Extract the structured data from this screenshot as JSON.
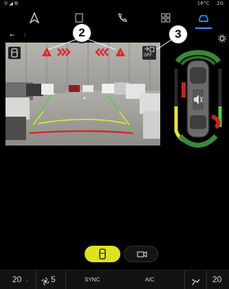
{
  "status": {
    "temperature": "16°C",
    "time": "20:"
  },
  "nav": {
    "items": [
      {
        "name": "navigation"
      },
      {
        "name": "media"
      },
      {
        "name": "phone"
      },
      {
        "name": "apps"
      },
      {
        "name": "vehicle"
      }
    ],
    "active": "vehicle"
  },
  "callouts": {
    "two": "2",
    "three": "3"
  },
  "camera": {
    "cross_traffic_label": "OFF"
  },
  "bottom_bar": {
    "left_temp": "20",
    "fan_speed": "5",
    "sync_label": "SYNC",
    "ac_label": "A/C",
    "right_temp": "20"
  },
  "colors": {
    "accent": "#3aa0ff",
    "active_button": "#dfe31e",
    "warning": "#e0262a",
    "guide_green": "#4bd23a",
    "guide_yellow": "#e8e23a",
    "guide_red": "#d9262a"
  }
}
